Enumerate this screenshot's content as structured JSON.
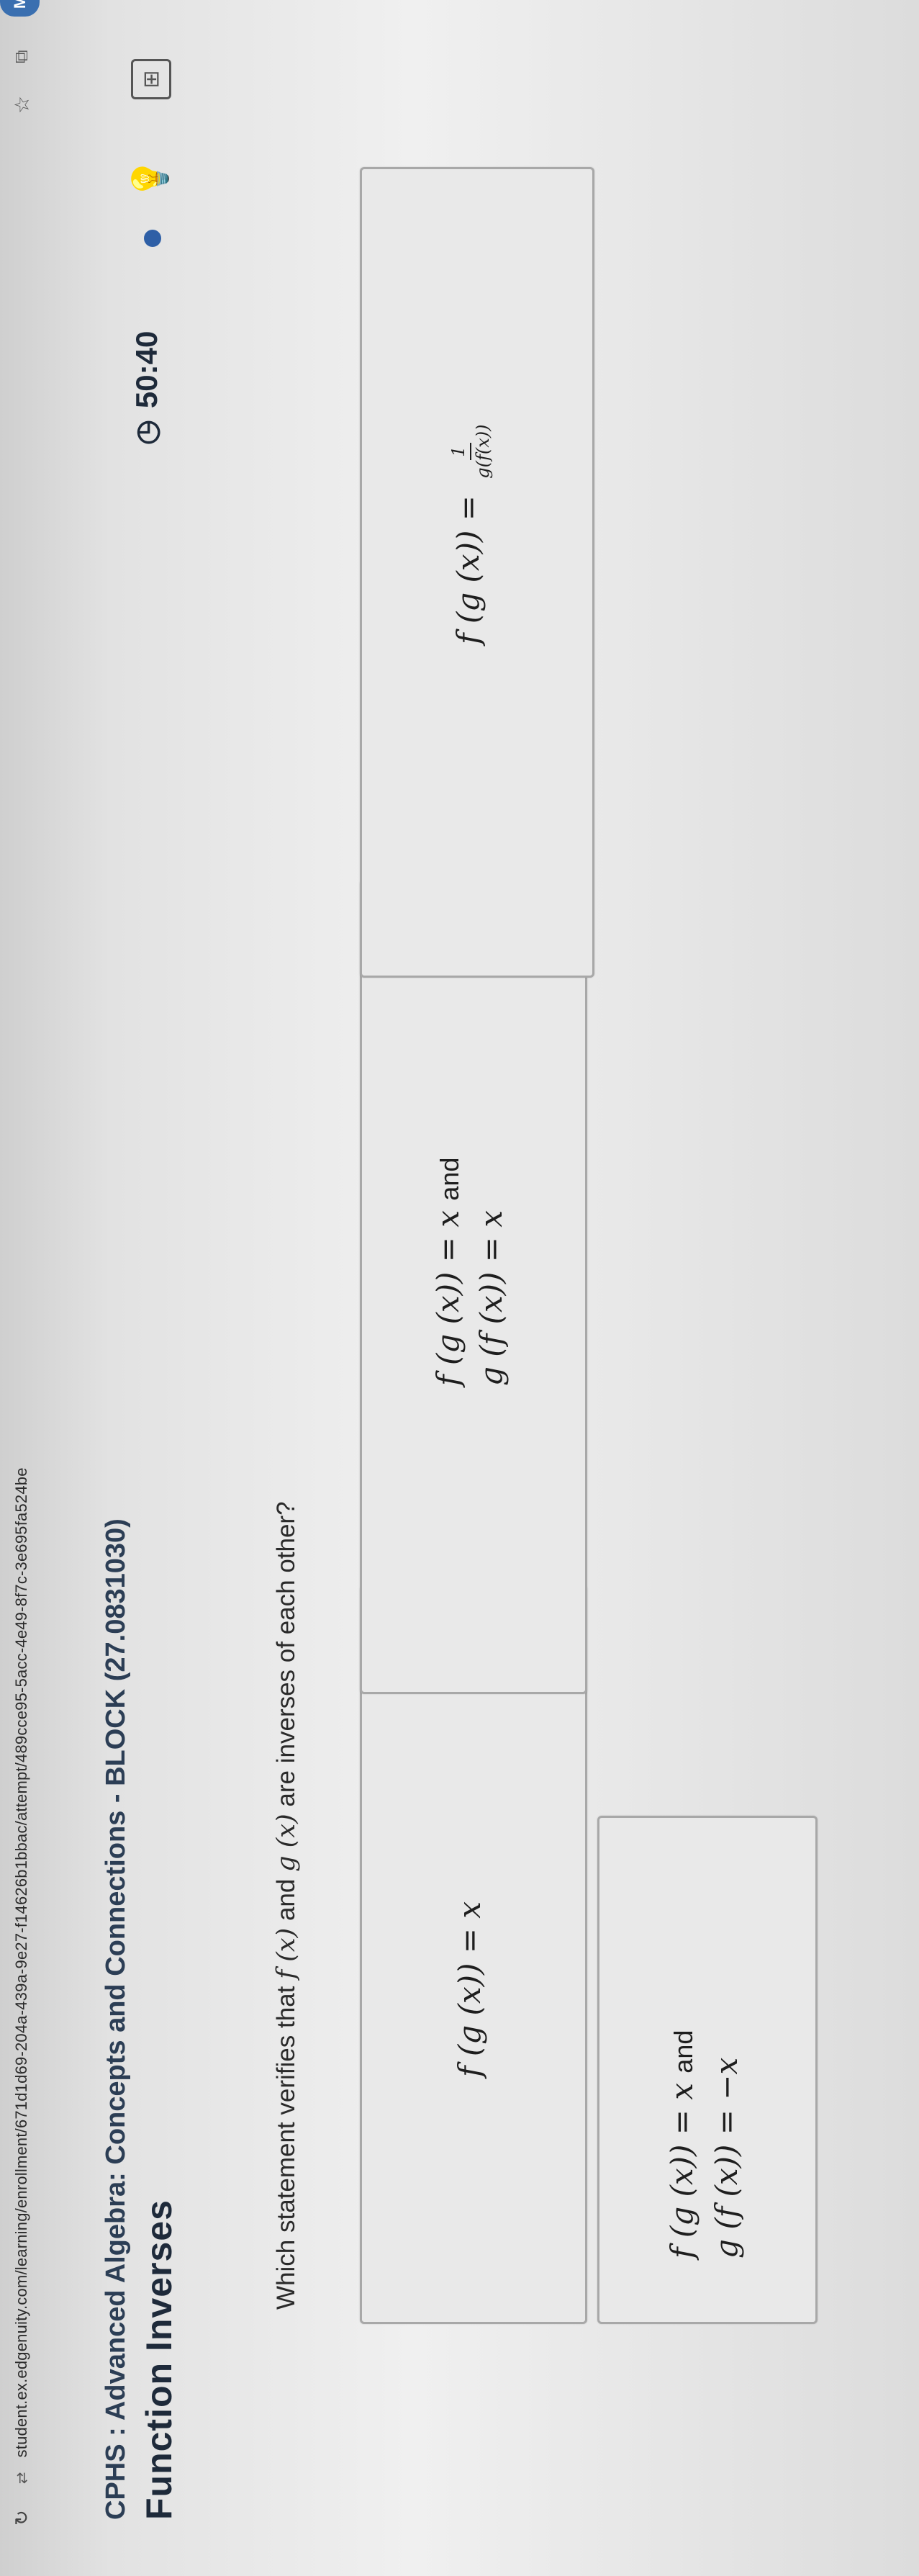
{
  "browser": {
    "url": "student.ex.edgenuity.com/learning/enrollment/671d1d69-204a-439a-9e27-f14626b1bbac/attempt/489cce95-5acc-4e49-8f7c-3e695fa524be",
    "avatar_initials": "M"
  },
  "header": {
    "course_title": "CPHS : Advanced Algebra: Concepts and Connections - BLOCK (27.0831030)",
    "lesson_title": "Function Inverses",
    "timer": "50:40"
  },
  "question": {
    "prefix": "Which statement verifies that",
    "f1": "f (x)",
    "and": "and",
    "g1": "g (x)",
    "suffix": "are inverses of each other?"
  },
  "options": [
    {
      "line1": "f (g (x)) = x",
      "line2": "",
      "and": ""
    },
    {
      "line1": "f (g (x)) = x",
      "line2": "g (f (x)) = x",
      "and": "and"
    },
    {
      "line1": "f (g (x)) = x",
      "line2": "g (f (x)) = −x",
      "and": "and"
    },
    {
      "lhs": "f (g (x)) =",
      "numerator": "1",
      "denominator": "g(f(x))"
    }
  ]
}
